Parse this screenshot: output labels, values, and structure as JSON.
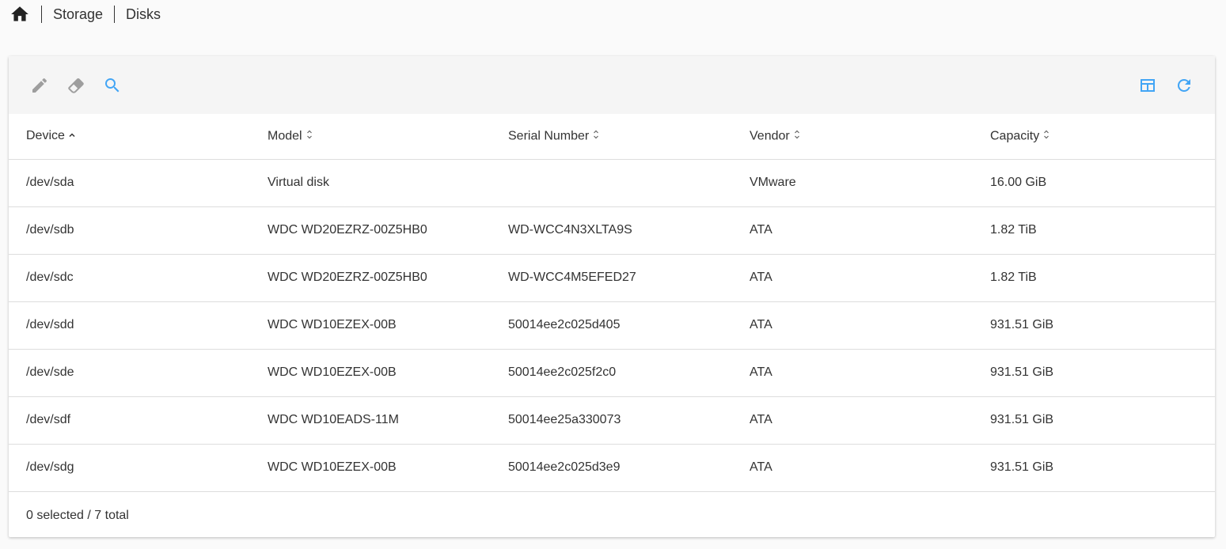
{
  "breadcrumb": {
    "home_icon": "home-icon",
    "items": [
      "Storage",
      "Disks"
    ]
  },
  "toolbar": {
    "left_icons": [
      "pencil-icon",
      "eraser-icon",
      "search-icon"
    ],
    "right_icons": [
      "table-columns-icon",
      "refresh-icon"
    ],
    "colors": {
      "disabled": "#9e9e9e",
      "active": "#42a5f5"
    }
  },
  "table": {
    "columns": [
      {
        "label": "Device",
        "sort": "asc"
      },
      {
        "label": "Model",
        "sort": "none"
      },
      {
        "label": "Serial Number",
        "sort": "none"
      },
      {
        "label": "Vendor",
        "sort": "none"
      },
      {
        "label": "Capacity",
        "sort": "none"
      }
    ],
    "rows": [
      [
        "/dev/sda",
        "Virtual disk",
        "",
        "VMware",
        "16.00 GiB"
      ],
      [
        "/dev/sdb",
        "WDC WD20EZRZ-00Z5HB0",
        "WD-WCC4N3XLTA9S",
        "ATA",
        "1.82 TiB"
      ],
      [
        "/dev/sdc",
        "WDC WD20EZRZ-00Z5HB0",
        "WD-WCC4M5EFED27",
        "ATA",
        "1.82 TiB"
      ],
      [
        "/dev/sdd",
        "WDC WD10EZEX-00B",
        "50014ee2c025d405",
        "ATA",
        "931.51 GiB"
      ],
      [
        "/dev/sde",
        "WDC WD10EZEX-00B",
        "50014ee2c025f2c0",
        "ATA",
        "931.51 GiB"
      ],
      [
        "/dev/sdf",
        "WDC WD10EADS-11M",
        "50014ee25a330073",
        "ATA",
        "931.51 GiB"
      ],
      [
        "/dev/sdg",
        "WDC WD10EZEX-00B",
        "50014ee2c025d3e9",
        "ATA",
        "931.51 GiB"
      ]
    ]
  },
  "footer": {
    "status": "0 selected / 7 total"
  }
}
